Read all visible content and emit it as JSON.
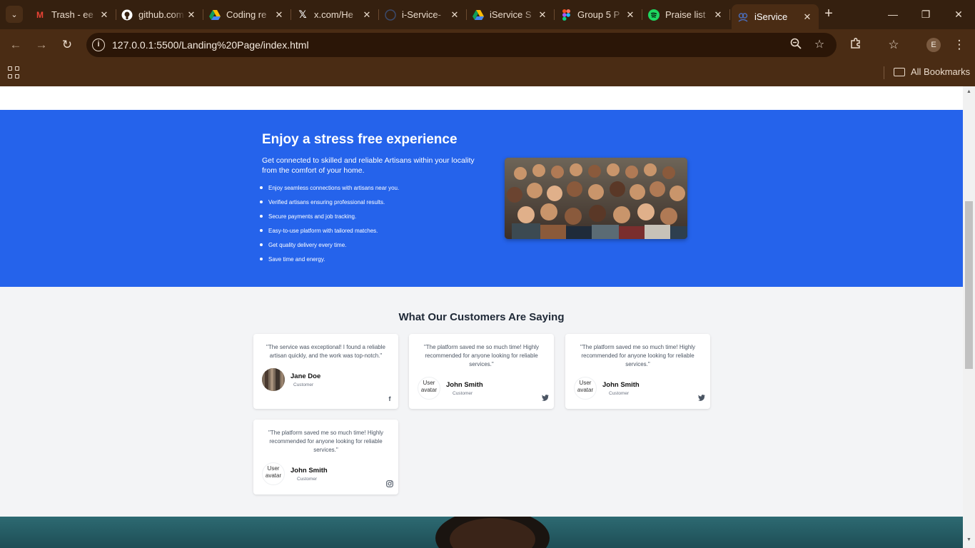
{
  "browser": {
    "tabs": [
      {
        "title": "Trash - ee",
        "icon": "gmail-icon",
        "active": false
      },
      {
        "title": "github.com",
        "icon": "github-icon",
        "active": false
      },
      {
        "title": "Coding re",
        "icon": "google-drive-icon",
        "active": false
      },
      {
        "title": "x.com/He",
        "icon": "x-icon",
        "active": false
      },
      {
        "title": "i-Service-",
        "icon": "github-icon",
        "active": false
      },
      {
        "title": "iService S",
        "icon": "google-drive-icon",
        "active": false
      },
      {
        "title": "Group 5 P",
        "icon": "figma-icon",
        "active": false
      },
      {
        "title": "Praise list",
        "icon": "spotify-icon",
        "active": false
      },
      {
        "title": "iService",
        "icon": "page-icon",
        "active": true
      }
    ],
    "url": "127.0.0.1:5500/Landing%20Page/index.html",
    "bookmarks_label": "All Bookmarks",
    "profile_initial": "E"
  },
  "hero": {
    "title": "Enjoy a stress free experience",
    "subtitle": "Get connected to skilled and reliable Artisans within your locality from the comfort of your home.",
    "features": [
      "Enjoy seamless connections with artisans near you.",
      "Verified artisans ensuring professional results.",
      "Secure payments and job tracking.",
      "Easy-to-use platform with tailored matches.",
      "Get quality delivery every time.",
      "Save time and energy."
    ],
    "image_icon": "group-of-people-photo",
    "bg_color": "#2563eb"
  },
  "testimonials": {
    "heading": "What Our Customers Are Saying",
    "cards": [
      {
        "quote": "\"The service was exceptional! I found a reliable artisan quickly, and the work was top-notch.\"",
        "name": "Jane Doe",
        "role": "Customer",
        "avatar_alt": "",
        "social": "facebook-icon"
      },
      {
        "quote": "\"The platform saved me so much time! Highly recommended for anyone looking for reliable services.\"",
        "name": "John Smith",
        "role": "Customer",
        "avatar_alt": "User avatar",
        "social": "twitter-icon"
      },
      {
        "quote": "\"The platform saved me so much time! Highly recommended for anyone looking for reliable services.\"",
        "name": "John Smith",
        "role": "Customer",
        "avatar_alt": "User avatar",
        "social": "twitter-icon"
      },
      {
        "quote": "\"The platform saved me so much time! Highly recommended for anyone looking for reliable services.\"",
        "name": "John Smith",
        "role": "Customer",
        "avatar_alt": "User avatar",
        "social": "instagram-icon"
      }
    ]
  }
}
